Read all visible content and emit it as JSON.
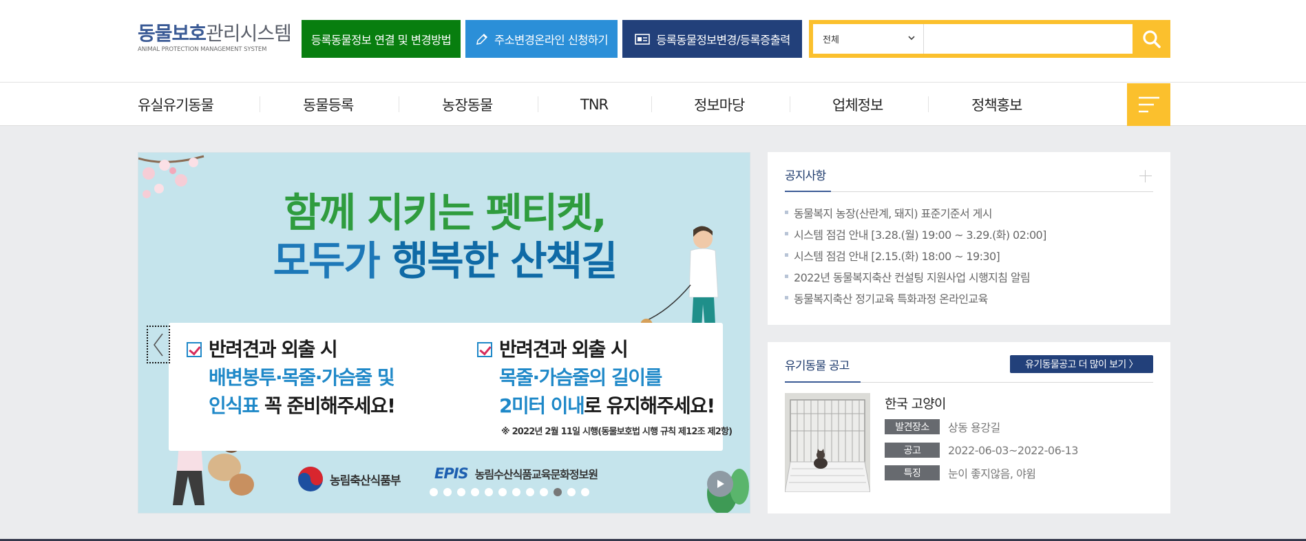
{
  "logo": {
    "main_part1": "동물보호",
    "main_part2": "관리시스템",
    "sub": "ANIMAL PROTECTION MANAGEMENT SYSTEM"
  },
  "header_buttons": [
    {
      "label": "등록동물정보 연결 및 변경방법"
    },
    {
      "label": "주소변경온라인 신청하기",
      "icon": "pencil-icon"
    },
    {
      "label": "등록동물정보변경/등록증출력",
      "icon": "id-card-icon"
    }
  ],
  "search": {
    "category": "전체",
    "placeholder": "",
    "value": ""
  },
  "nav": [
    {
      "label": "유실유기동물"
    },
    {
      "label": "동물등록"
    },
    {
      "label": "농장동물"
    },
    {
      "label": "TNR"
    },
    {
      "label": "정보마당"
    },
    {
      "label": "업체정보"
    },
    {
      "label": "정책홍보"
    }
  ],
  "banner": {
    "title_line1": "함께 지키는 펫티켓,",
    "title_line2a": "모두가 ",
    "title_line2b": "행복한 산책길",
    "col1": {
      "head": "반려견과 외출 시",
      "line2": "배변봉투·목줄·가슴줄 및",
      "line3_blue": "인식표",
      "line3_black": " 꼭 준비해주세요!"
    },
    "col2": {
      "head": "반려견과 외출 시",
      "line2": "목줄·가슴줄의 길이를",
      "line3_blue": "2미터 이내",
      "line3_black": "로 유지해주세요!"
    },
    "note": "※ 2022년 2월 11일 시행(동물보호법 시행 규칙 제12조 제2항)",
    "logo1": "농림축산식품부",
    "logo2_mark": "EPIS",
    "logo2": "농림수산식품교육문화정보원",
    "slide_count": 12,
    "active_slide": 10
  },
  "notice": {
    "title": "공지사항",
    "items": [
      "동물복지 농장(산란계, 돼지) 표준기준서 게시",
      "시스템 점검 안내 [3.28.(월) 19:00 ~ 3.29.(화) 02:00]",
      "시스템 점검 안내 [2.15.(화) 18:00 ~ 19:30]",
      "2022년 동물복지축산 컨설팅 지원사업 시행지침 알림",
      "동물복지축산 정기교육 특화과정 온라인교육"
    ]
  },
  "lost": {
    "title": "유기동물 공고",
    "more_label": "유기동물공고 더 많이 보기 〉",
    "animal_name": "한국 고양이",
    "rows": [
      {
        "tag": "발견장소",
        "value": "상동 용강길"
      },
      {
        "tag": "공고",
        "value": "2022-06-03~2022-06-13"
      },
      {
        "tag": "특징",
        "value": "눈이 좋지않음, 야윔"
      }
    ]
  },
  "colors": {
    "accent_yellow": "#fbc02d",
    "green_button": "#087e0f",
    "blue_button": "#2b8fd8",
    "navy_button": "#22407a",
    "logo_blue": "#3a5a95"
  }
}
